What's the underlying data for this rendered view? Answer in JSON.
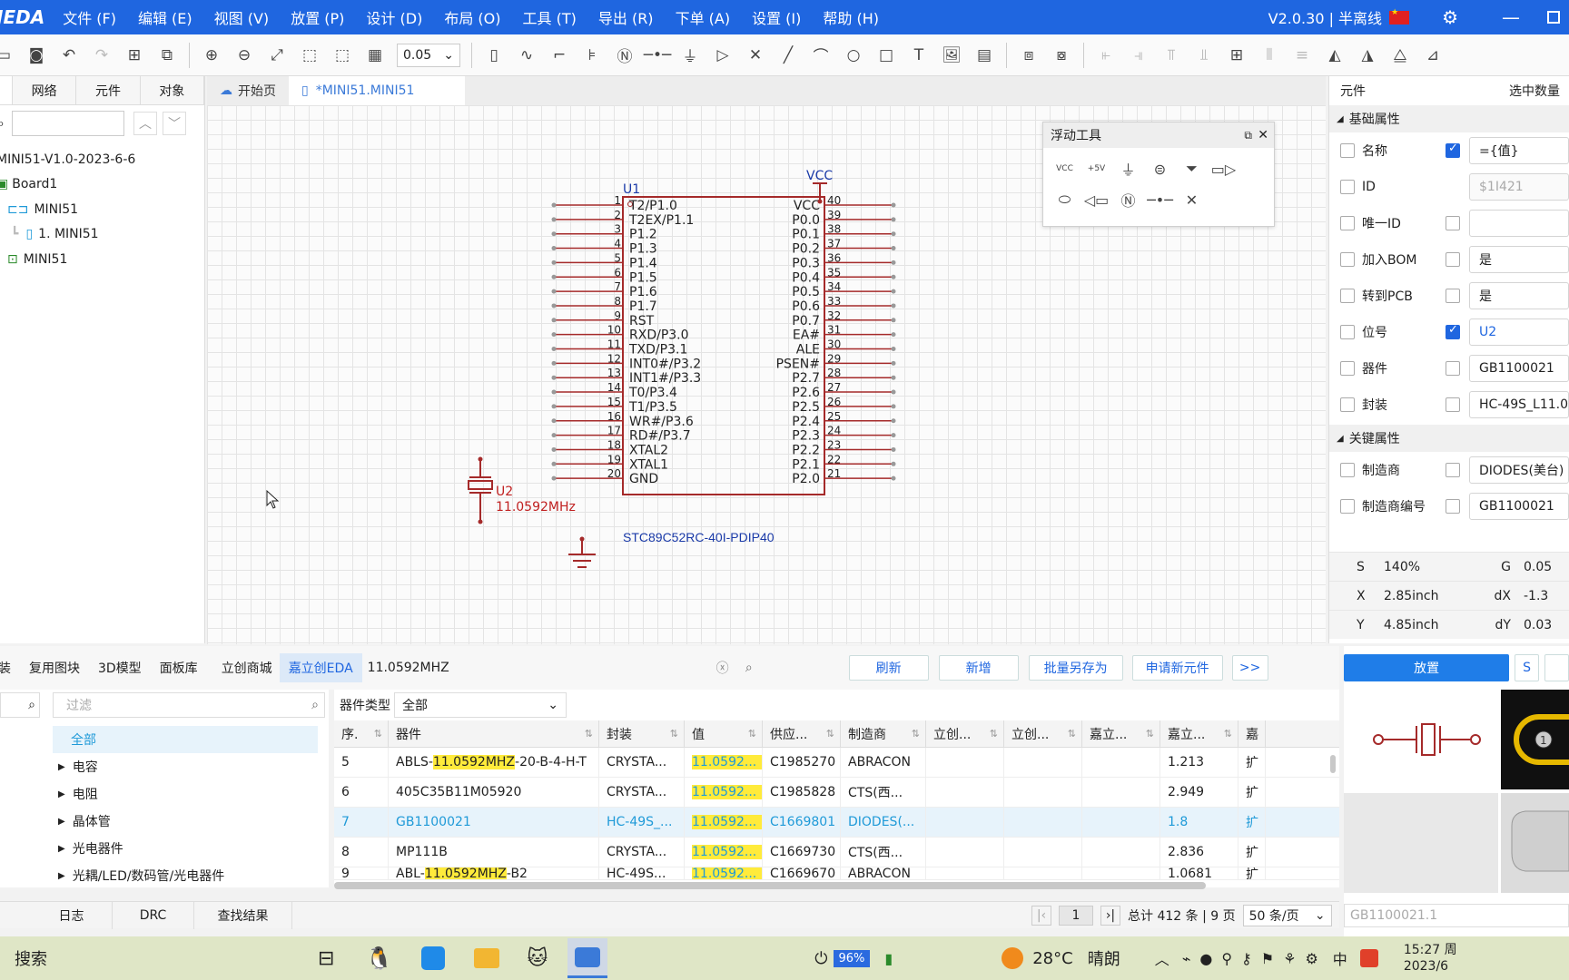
{
  "menubar": {
    "logo": "JEDA",
    "items": [
      "文件 (F)",
      "编辑 (E)",
      "视图 (V)",
      "放置 (P)",
      "设计 (D)",
      "布局 (O)",
      "工具 (T)",
      "导出 (R)",
      "下单 (A)",
      "设置 (I)",
      "帮助 (H)"
    ],
    "version": "V2.0.30 | 半离线"
  },
  "toolbar": {
    "zoom": "0.05"
  },
  "left_panel": {
    "tabs": [
      "网络",
      "元件",
      "对象"
    ],
    "tree": [
      "MINI51-V1.0-2023-6-6",
      "Board1",
      "MINI51",
      "1. MINI51",
      "MINI51"
    ]
  },
  "doc_tabs": {
    "home": "开始页",
    "active": "*MINI51.MINI51"
  },
  "schematic": {
    "u1_ref": "U1",
    "u1_part": "STC89C52RC-40I-PDIP40",
    "vcc": "VCC",
    "crystal_ref": "U2",
    "crystal_value": "11.0592MHz",
    "left_pins": [
      {
        "num": "1",
        "name": "T2/P1.0"
      },
      {
        "num": "2",
        "name": "T2EX/P1.1"
      },
      {
        "num": "3",
        "name": "P1.2"
      },
      {
        "num": "4",
        "name": "P1.3"
      },
      {
        "num": "5",
        "name": "P1.4"
      },
      {
        "num": "6",
        "name": "P1.5"
      },
      {
        "num": "7",
        "name": "P1.6"
      },
      {
        "num": "8",
        "name": "P1.7"
      },
      {
        "num": "9",
        "name": "RST"
      },
      {
        "num": "10",
        "name": "RXD/P3.0"
      },
      {
        "num": "11",
        "name": "TXD/P3.1"
      },
      {
        "num": "12",
        "name": "INT0#/P3.2"
      },
      {
        "num": "13",
        "name": "INT1#/P3.3"
      },
      {
        "num": "14",
        "name": "T0/P3.4"
      },
      {
        "num": "15",
        "name": "T1/P3.5"
      },
      {
        "num": "16",
        "name": "WR#/P3.6"
      },
      {
        "num": "17",
        "name": "RD#/P3.7"
      },
      {
        "num": "18",
        "name": "XTAL2"
      },
      {
        "num": "19",
        "name": "XTAL1"
      },
      {
        "num": "20",
        "name": "GND"
      }
    ],
    "right_pins": [
      {
        "num": "40",
        "name": "VCC"
      },
      {
        "num": "39",
        "name": "P0.0"
      },
      {
        "num": "38",
        "name": "P0.1"
      },
      {
        "num": "37",
        "name": "P0.2"
      },
      {
        "num": "36",
        "name": "P0.3"
      },
      {
        "num": "35",
        "name": "P0.4"
      },
      {
        "num": "34",
        "name": "P0.5"
      },
      {
        "num": "33",
        "name": "P0.6"
      },
      {
        "num": "32",
        "name": "P0.7"
      },
      {
        "num": "31",
        "name": "EA#"
      },
      {
        "num": "30",
        "name": "ALE"
      },
      {
        "num": "29",
        "name": "PSEN#"
      },
      {
        "num": "28",
        "name": "P2.7"
      },
      {
        "num": "27",
        "name": "P2.6"
      },
      {
        "num": "26",
        "name": "P2.5"
      },
      {
        "num": "25",
        "name": "P2.4"
      },
      {
        "num": "24",
        "name": "P2.3"
      },
      {
        "num": "23",
        "name": "P2.2"
      },
      {
        "num": "22",
        "name": "P2.1"
      },
      {
        "num": "21",
        "name": "P2.0"
      }
    ]
  },
  "float_tools": {
    "title": "浮动工具",
    "items": [
      "VCC",
      "+5V"
    ]
  },
  "right_panel": {
    "title": "元件",
    "selected": "选中数量",
    "section_basic": "基础属性",
    "section_key": "关键属性",
    "props": [
      {
        "label": "名称",
        "value": "={值}",
        "checked": true,
        "style": "normal"
      },
      {
        "label": "ID",
        "value": "$1I421",
        "checked": null,
        "style": "dis"
      },
      {
        "label": "唯一ID",
        "value": "",
        "checked": false,
        "style": "normal"
      },
      {
        "label": "加入BOM",
        "value": "是",
        "checked": false,
        "style": "normal"
      },
      {
        "label": "转到PCB",
        "value": "是",
        "checked": false,
        "style": "normal"
      },
      {
        "label": "位号",
        "value": "U2",
        "checked": true,
        "style": "blue"
      },
      {
        "label": "器件",
        "value": "GB1100021",
        "checked": false,
        "style": "normal"
      },
      {
        "label": "封装",
        "value": "HC-49S_L11.0",
        "checked": false,
        "style": "normal"
      }
    ],
    "key_props": [
      {
        "label": "制造商",
        "value": "DIODES(美台)",
        "checked": false
      },
      {
        "label": "制造商编号",
        "value": "GB1100021",
        "checked": false
      }
    ],
    "coords": [
      {
        "k1": "S",
        "v1": "140%",
        "k2": "G",
        "v2": "0.05"
      },
      {
        "k1": "X",
        "v1": "2.85inch",
        "k2": "dX",
        "v2": "-1.3"
      },
      {
        "k1": "Y",
        "v1": "4.85inch",
        "k2": "dY",
        "v2": "0.03"
      }
    ]
  },
  "library": {
    "tabs": [
      "装",
      "复用图块",
      "3D模型",
      "面板库",
      "立创商城",
      "嘉立创EDA"
    ],
    "search": "11.0592MHZ",
    "buttons": [
      "刷新",
      "新增",
      "批量另存为",
      "申请新元件",
      ">>"
    ],
    "filter_placeholder": "过滤",
    "type_label": "器件类型",
    "type_value": "全部",
    "categories": [
      "全部",
      "电容",
      "电阻",
      "晶体管",
      "光电器件",
      "光耦/LED/数码管/光电器件"
    ],
    "columns": [
      "序.",
      "器件",
      "封装",
      "值",
      "供应...",
      "制造商",
      "立创...",
      "立创...",
      "嘉立...",
      "嘉立...",
      "嘉"
    ],
    "rows": [
      {
        "no": "5",
        "pre": "ABLS-",
        "hl": "11.0592MHZ",
        "post": "-20-B-4-H-T",
        "pkg": "CRYSTA...",
        "val": "11.0592...",
        "sup": "C1985270",
        "mfr": "ABRACON",
        "p": "1.213",
        "last": "扩"
      },
      {
        "no": "6",
        "pre": "405C35B11M05920",
        "hl": "",
        "post": "",
        "pkg": "CRYSTA...",
        "val": "11.0592...",
        "sup": "C1985828",
        "mfr": "CTS(西...",
        "p": "2.949",
        "last": "扩"
      },
      {
        "no": "7",
        "pre": "GB1100021",
        "hl": "",
        "post": "",
        "pkg": "HC-49S_...",
        "val": "11.0592...",
        "sup": "C1669801",
        "mfr": "DIODES(...",
        "p": "1.8",
        "last": "扩"
      },
      {
        "no": "8",
        "pre": "MP111B",
        "hl": "",
        "post": "",
        "pkg": "CRYSTA...",
        "val": "11.0592...",
        "sup": "C1669730",
        "mfr": "CTS(西...",
        "p": "2.836",
        "last": "扩"
      },
      {
        "no": "9",
        "pre": "ABL-",
        "hl": "11.0592MHZ",
        "post": "-B2",
        "pkg": "HC-49S...",
        "val": "11.0592...",
        "sup": "C1669670",
        "mfr": "ABRACON",
        "p": "1.0681",
        "last": "扩"
      }
    ]
  },
  "preview": {
    "place_btn": "放置",
    "s_btn": "S",
    "part_name": "GB1100021.1"
  },
  "statusbar": {
    "tabs": [
      "日志",
      "DRC",
      "查找结果"
    ],
    "page": "1",
    "total": "总计 412 条 | 9 页",
    "per_page": "50 条/页"
  },
  "taskbar": {
    "search": "搜索",
    "battery": "96%",
    "weather_temp": "28°C",
    "weather_text": "晴朗",
    "time": "15:27 周",
    "date": "2023/6"
  }
}
